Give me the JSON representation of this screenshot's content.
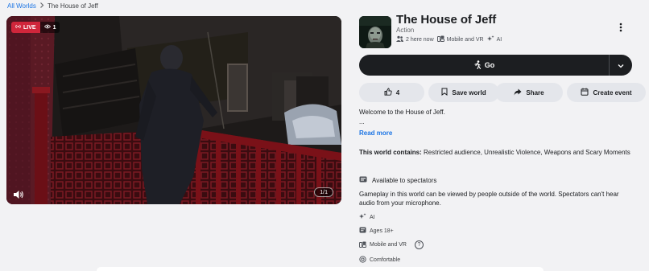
{
  "breadcrumb": {
    "root": "All Worlds",
    "current": "The House of Jeff"
  },
  "media": {
    "live_label": "LIVE",
    "viewer_count": "1",
    "counter": "1/1"
  },
  "world": {
    "title": "The House of Jeff",
    "genre": "Action",
    "here_now": "2 here now",
    "platform": "Mobile and VR",
    "ai_tag": "AI"
  },
  "actions": {
    "go_label": "Go",
    "like_count": "4",
    "save_label": "Save world",
    "share_label": "Share",
    "event_label": "Create event"
  },
  "description": {
    "text": "Welcome to the House of Jeff.",
    "ellipsis": "...",
    "read_more": "Read more"
  },
  "content_warning": {
    "label": "This world contains:",
    "items": "Restricted audience, Unrealistic Violence, Weapons and Scary Moments"
  },
  "spectators": {
    "title": "Available to spectators",
    "desc": "Gameplay in this world can be viewed by people outside of the world. Spectators can't hear audio from your microphone."
  },
  "details": {
    "ai": "AI",
    "ages": "Ages 18+",
    "platform": "Mobile and VR",
    "help": "?",
    "comfort": "Comfortable"
  },
  "colors": {
    "accent": "#1b74e4",
    "live": "#d0263b",
    "dark_button": "#1c1e21",
    "pill": "#e4e6eb"
  }
}
